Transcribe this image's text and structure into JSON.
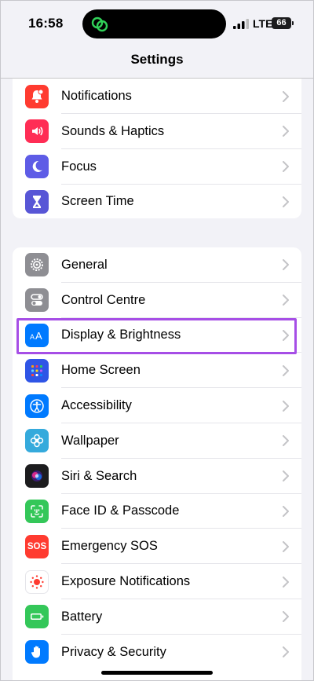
{
  "status_bar": {
    "time": "16:58",
    "network": "LTE",
    "battery": "66"
  },
  "nav": {
    "title": "Settings"
  },
  "groups": [
    {
      "items": [
        {
          "label": "Notifications",
          "icon": "bell-icon",
          "color": "#ff3b30"
        },
        {
          "label": "Sounds & Haptics",
          "icon": "speaker-icon",
          "color": "#ff2d55"
        },
        {
          "label": "Focus",
          "icon": "moon-icon",
          "color": "#5e5ce6"
        },
        {
          "label": "Screen Time",
          "icon": "hourglass-icon",
          "color": "#5856d6"
        }
      ]
    },
    {
      "items": [
        {
          "label": "General",
          "icon": "gear-icon",
          "color": "#8e8e93"
        },
        {
          "label": "Control Centre",
          "icon": "toggles-icon",
          "color": "#8e8e93"
        },
        {
          "label": "Display & Brightness",
          "icon": "text-size-icon",
          "color": "#007aff",
          "highlighted": true
        },
        {
          "label": "Home Screen",
          "icon": "home-grid-icon",
          "color": "#2f55e6"
        },
        {
          "label": "Accessibility",
          "icon": "accessibility-icon",
          "color": "#007aff"
        },
        {
          "label": "Wallpaper",
          "icon": "flower-icon",
          "color": "#35aadc"
        },
        {
          "label": "Siri & Search",
          "icon": "siri-icon",
          "color": "#1c1c1e"
        },
        {
          "label": "Face ID & Passcode",
          "icon": "face-id-icon",
          "color": "#34c759"
        },
        {
          "label": "Emergency SOS",
          "icon": "sos-icon",
          "color": "#ff3b30",
          "icon_text": "SOS"
        },
        {
          "label": "Exposure Notifications",
          "icon": "exposure-icon",
          "color": "#ffffff"
        },
        {
          "label": "Battery",
          "icon": "battery-icon",
          "color": "#34c759"
        },
        {
          "label": "Privacy & Security",
          "icon": "hand-icon",
          "color": "#007aff"
        }
      ]
    }
  ],
  "highlight_color": "#a64ee6"
}
